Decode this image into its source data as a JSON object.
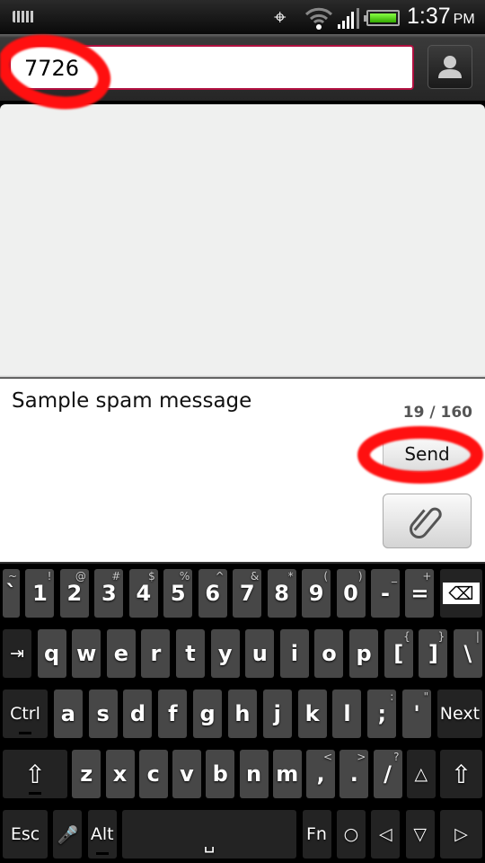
{
  "status_bar": {
    "time": "1:37",
    "ampm": "PM",
    "icons": [
      "keyboard-icon",
      "gps-icon",
      "wifi-icon",
      "signal-icon",
      "battery-icon"
    ],
    "battery_level": 1.0
  },
  "recipient": {
    "value": "7726"
  },
  "compose": {
    "message": "Sample spam message",
    "char_count": "19 / 160",
    "send_label": "Send"
  },
  "keyboard": {
    "rows": [
      [
        {
          "l": "`",
          "s": "~",
          "k": "narrow"
        },
        {
          "l": "1",
          "s": "!"
        },
        {
          "l": "2",
          "s": "@"
        },
        {
          "l": "3",
          "s": "#"
        },
        {
          "l": "4",
          "s": "$"
        },
        {
          "l": "5",
          "s": "%"
        },
        {
          "l": "6",
          "s": "^"
        },
        {
          "l": "7",
          "s": "&"
        },
        {
          "l": "8",
          "s": "*"
        },
        {
          "l": "9",
          "s": "("
        },
        {
          "l": "0",
          "s": ")"
        },
        {
          "l": "-",
          "s": "_"
        },
        {
          "l": "=",
          "s": "+"
        },
        {
          "l": "⌫",
          "k": "backspace"
        }
      ],
      [
        {
          "l": "⇥",
          "k": "tab"
        },
        {
          "l": "q"
        },
        {
          "l": "w"
        },
        {
          "l": "e"
        },
        {
          "l": "r"
        },
        {
          "l": "t"
        },
        {
          "l": "y"
        },
        {
          "l": "u"
        },
        {
          "l": "i"
        },
        {
          "l": "o"
        },
        {
          "l": "p"
        },
        {
          "l": "[",
          "s": "{"
        },
        {
          "l": "]",
          "s": "}"
        },
        {
          "l": "\\",
          "s": "|"
        }
      ],
      [
        {
          "l": "Ctrl",
          "k": "ctrl"
        },
        {
          "l": "a"
        },
        {
          "l": "s"
        },
        {
          "l": "d"
        },
        {
          "l": "f"
        },
        {
          "l": "g"
        },
        {
          "l": "h"
        },
        {
          "l": "j"
        },
        {
          "l": "k"
        },
        {
          "l": "l"
        },
        {
          "l": ";",
          "s": ":"
        },
        {
          "l": "'",
          "s": "\""
        },
        {
          "l": "Next",
          "k": "next"
        }
      ],
      [
        {
          "l": "⇧",
          "k": "shift-left"
        },
        {
          "l": "z"
        },
        {
          "l": "x"
        },
        {
          "l": "c"
        },
        {
          "l": "v"
        },
        {
          "l": "b"
        },
        {
          "l": "n"
        },
        {
          "l": "m"
        },
        {
          "l": ",",
          "s": "<"
        },
        {
          "l": ".",
          "s": ">"
        },
        {
          "l": "/",
          "s": "?"
        },
        {
          "l": "△",
          "k": "up"
        },
        {
          "l": "⇧",
          "k": "shift-right"
        }
      ],
      [
        {
          "l": "Esc",
          "k": "esc"
        },
        {
          "l": "🎤",
          "k": "mic"
        },
        {
          "l": "Alt",
          "k": "alt"
        },
        {
          "l": "␣",
          "k": "space"
        },
        {
          "l": "Fn",
          "k": "fnkey"
        },
        {
          "l": "○",
          "k": "home"
        },
        {
          "l": "◁",
          "k": "left"
        },
        {
          "l": "▽",
          "k": "down"
        },
        {
          "l": "▷",
          "k": "right"
        }
      ]
    ]
  },
  "annotation_color": "#ff1010"
}
